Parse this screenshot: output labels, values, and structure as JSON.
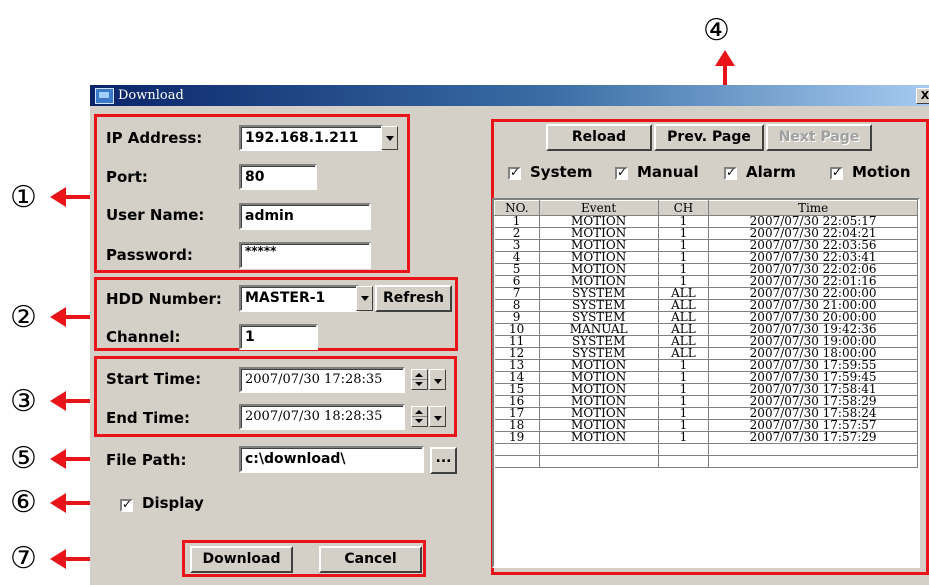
{
  "callouts": [
    "①",
    "②",
    "③",
    "④",
    "⑤",
    "⑥",
    "⑦"
  ],
  "window": {
    "title": "Download",
    "close_label": "X"
  },
  "connection": {
    "ip_label": "IP Address:",
    "ip_value": "192.168.1.211",
    "port_label": "Port:",
    "port_value": "80",
    "user_label": "User Name:",
    "user_value": "admin",
    "password_label": "Password:",
    "password_value": "*****"
  },
  "hdd": {
    "hdd_label": "HDD Number:",
    "hdd_value": "MASTER-1",
    "refresh_label": "Refresh",
    "channel_label": "Channel:",
    "channel_value": "1"
  },
  "time": {
    "start_label": "Start Time:",
    "start_value": "2007/07/30 17:28:35",
    "end_label": "End Time:",
    "end_value": "2007/07/30 18:28:35"
  },
  "file": {
    "path_label": "File Path:",
    "path_value": "c:\\download\\",
    "browse_label": "..."
  },
  "display": {
    "label": "Display",
    "checked": true
  },
  "actions": {
    "download_label": "Download",
    "cancel_label": "Cancel"
  },
  "events_panel": {
    "reload_label": "Reload",
    "prev_label": "Prev. Page",
    "next_label": "Next Page",
    "filters": [
      {
        "label": "System",
        "checked": true
      },
      {
        "label": "Manual",
        "checked": true
      },
      {
        "label": "Alarm",
        "checked": true
      },
      {
        "label": "Motion",
        "checked": true
      }
    ],
    "columns": [
      "NO.",
      "Event",
      "CH",
      "Time"
    ],
    "rows": [
      [
        "1",
        "MOTION",
        "1",
        "2007/07/30 22:05:17"
      ],
      [
        "2",
        "MOTION",
        "1",
        "2007/07/30 22:04:21"
      ],
      [
        "3",
        "MOTION",
        "1",
        "2007/07/30 22:03:56"
      ],
      [
        "4",
        "MOTION",
        "1",
        "2007/07/30 22:03:41"
      ],
      [
        "5",
        "MOTION",
        "1",
        "2007/07/30 22:02:06"
      ],
      [
        "6",
        "MOTION",
        "1",
        "2007/07/30 22:01:16"
      ],
      [
        "7",
        "SYSTEM",
        "ALL",
        "2007/07/30 22:00:00"
      ],
      [
        "8",
        "SYSTEM",
        "ALL",
        "2007/07/30 21:00:00"
      ],
      [
        "9",
        "SYSTEM",
        "ALL",
        "2007/07/30 20:00:00"
      ],
      [
        "10",
        "MANUAL",
        "ALL",
        "2007/07/30 19:42:36"
      ],
      [
        "11",
        "SYSTEM",
        "ALL",
        "2007/07/30 19:00:00"
      ],
      [
        "12",
        "SYSTEM",
        "ALL",
        "2007/07/30 18:00:00"
      ],
      [
        "13",
        "MOTION",
        "1",
        "2007/07/30 17:59:55"
      ],
      [
        "14",
        "MOTION",
        "1",
        "2007/07/30 17:59:45"
      ],
      [
        "15",
        "MOTION",
        "1",
        "2007/07/30 17:58:41"
      ],
      [
        "16",
        "MOTION",
        "1",
        "2007/07/30 17:58:29"
      ],
      [
        "17",
        "MOTION",
        "1",
        "2007/07/30 17:58:24"
      ],
      [
        "18",
        "MOTION",
        "1",
        "2007/07/30 17:57:57"
      ],
      [
        "19",
        "MOTION",
        "1",
        "2007/07/30 17:57:29"
      ]
    ]
  },
  "colors": {
    "highlight": "#e8141a",
    "dialog": "#d4d0c8",
    "titlebar": "#0a246a"
  }
}
